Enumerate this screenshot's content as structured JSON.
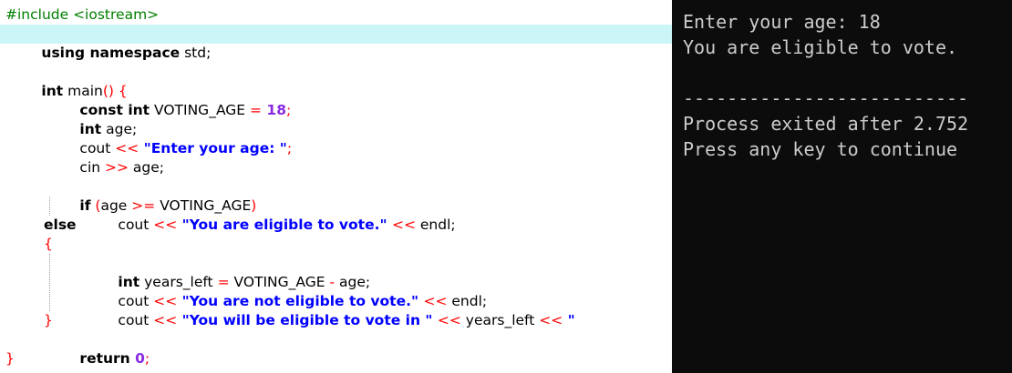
{
  "editor": {
    "line1": {
      "directive": "#include <iostream>"
    },
    "line2": {
      "kw": "using namespace",
      "rest": " std;"
    },
    "line4": {
      "kw": "int",
      "name": " main",
      "paren": "()",
      "brace": " {"
    },
    "line5": {
      "kw": "const int",
      "name": " VOTING_AGE ",
      "op": "=",
      "num": " 18",
      "semi": ";"
    },
    "line6": {
      "kw": "int",
      "rest": " age;"
    },
    "line7": {
      "name": "cout ",
      "op": "<<",
      "str": " \"Enter your age: \"",
      "semi": ";"
    },
    "line8": {
      "name": "cin ",
      "op": ">>",
      "rest": " age;"
    },
    "line10": {
      "kw": "if",
      "paren_open": " (",
      "a": "age ",
      "op": ">=",
      "b": " VOTING_AGE",
      "paren_close": ")"
    },
    "line11": {
      "name": "cout ",
      "op1": "<<",
      "str": " \"You are eligible to vote.\" ",
      "op2": "<<",
      "rest": " endl;"
    },
    "line12": {
      "kw": "else"
    },
    "line13": {
      "brace": "{"
    },
    "line14": {
      "kw": "int",
      "name": " years_left ",
      "op1": "=",
      "a": " VOTING_AGE ",
      "op2": "-",
      "rest": " age;"
    },
    "line15": {
      "name": "cout ",
      "op1": "<<",
      "str": " \"You are not eligible to vote.\" ",
      "op2": "<<",
      "rest": " endl;"
    },
    "line16": {
      "name": "cout ",
      "op1": "<<",
      "str": " \"You will be eligible to vote in \" ",
      "op2": "<<",
      "mid": " years_left ",
      "op3": "<<",
      "tail": " \""
    },
    "line17": {
      "brace": "}"
    },
    "line18": {
      "kw": "return",
      "num": " 0",
      "semi": ";"
    },
    "line19": {
      "brace": "}"
    }
  },
  "console": {
    "prompt_line": "Enter your age: 18",
    "result_line": "You are eligible to vote.",
    "separator": "--------------------------",
    "process_line": "Process exited after 2.752",
    "continue_line": "Press any key to continue"
  },
  "colors": {
    "current_line": "#ccf5f7",
    "preprocessor": "#008000",
    "string": "#0000ff",
    "number": "#8a2be2",
    "operator": "#ff0000",
    "console_bg": "#0c0c0c",
    "console_text": "#cccccc"
  }
}
